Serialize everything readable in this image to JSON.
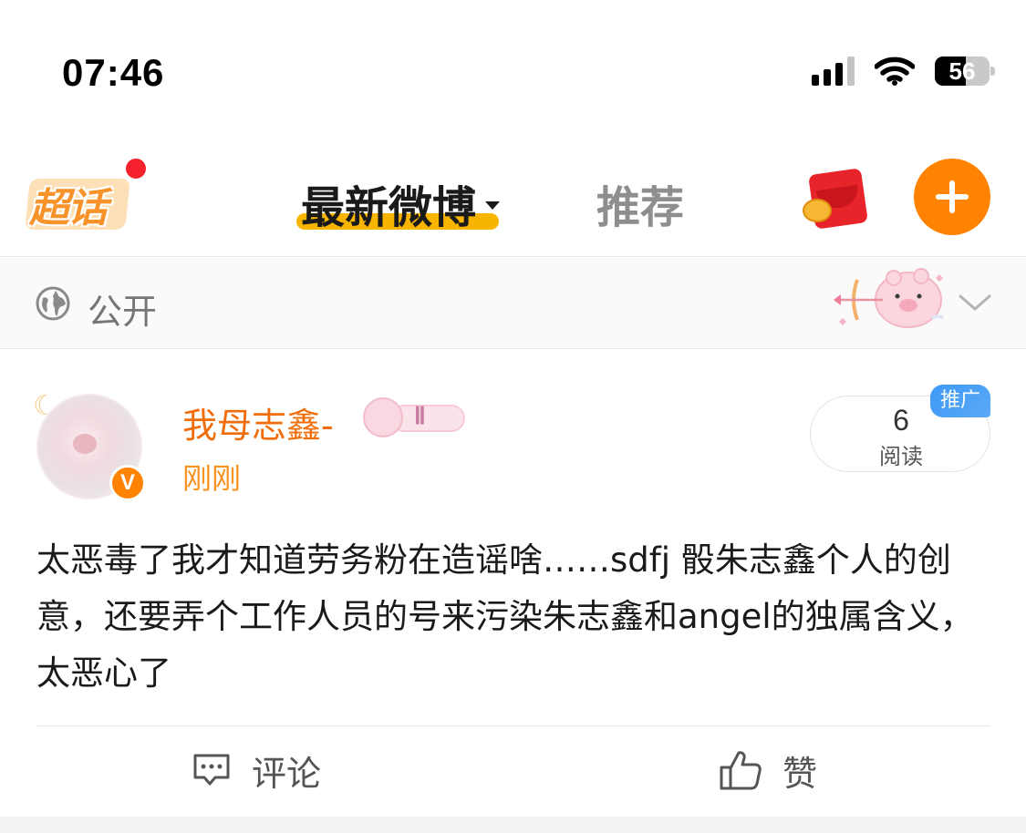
{
  "status_bar": {
    "time": "07:46",
    "battery_level": "56",
    "icons": [
      "cellular-signal-icon",
      "wifi-icon",
      "battery-icon"
    ]
  },
  "nav": {
    "chaohua_label": "超话",
    "tab_latest": "最新微博",
    "tab_recommend": "推荐",
    "accent_color": "#ff8200",
    "underline_color": "#f8b500"
  },
  "visibility": {
    "label": "公开"
  },
  "post": {
    "username": "我母志鑫-",
    "user_level": "Ⅱ",
    "time": "刚刚",
    "verified_badge": "V",
    "reads_count": "6",
    "reads_label": "阅读",
    "promo_label": "推广",
    "content": "太恶毒了我才知道劳务粉在造谣啥……sdfj 骰朱志鑫个人的创意，还要弄个工作人员的号来污染朱志鑫和angel的独属含义，太恶心了",
    "actions": {
      "comment_label": "评论",
      "like_label": "赞"
    }
  }
}
